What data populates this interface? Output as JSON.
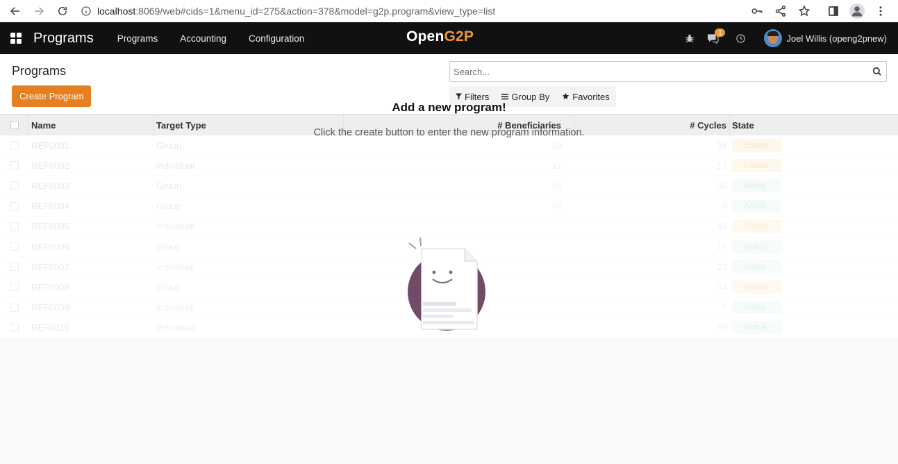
{
  "browser": {
    "url_host": "localhost",
    "url_path": ":8069/web#cids=1&menu_id=275&action=378&model=g2p.program&view_type=list"
  },
  "navbar": {
    "app_title": "Programs",
    "menu": [
      "Programs",
      "Accounting",
      "Configuration"
    ],
    "brand_part1": "Open",
    "brand_part2": "G2P",
    "messages_badge": "1",
    "user_name": "Joel Willis (openg2pnew)",
    "accent_color": "#f0972e"
  },
  "control": {
    "title": "Programs",
    "create_label": "Create Program",
    "search_placeholder": "Search...",
    "filters_label": "Filters",
    "group_by_label": "Group By",
    "favorites_label": "Favorites"
  },
  "table": {
    "headers": {
      "name": "Name",
      "target_type": "Target Type",
      "beneficiaries": "# Beneficiaries",
      "cycles": "# Cycles",
      "state": "State"
    },
    "rows": [
      {
        "name": "REF0001",
        "type": "Group",
        "beneficiaries": "39",
        "cycles": "38",
        "state": "Ended"
      },
      {
        "name": "REF0002",
        "type": "Individual",
        "beneficiaries": "17",
        "cycles": "17",
        "state": "Ended"
      },
      {
        "name": "REF0003",
        "type": "Group",
        "beneficiaries": "34",
        "cycles": "38",
        "state": "Active"
      },
      {
        "name": "REF0004",
        "type": "Group",
        "beneficiaries": "24",
        "cycles": "9",
        "state": "Active"
      },
      {
        "name": "REF0005",
        "type": "Individual",
        "beneficiaries": "",
        "cycles": "49",
        "state": "Ended"
      },
      {
        "name": "REF0006",
        "type": "Group",
        "beneficiaries": "",
        "cycles": "17",
        "state": "Active"
      },
      {
        "name": "REF0007",
        "type": "Individual",
        "beneficiaries": "",
        "cycles": "23",
        "state": "Active"
      },
      {
        "name": "REF0008",
        "type": "Group",
        "beneficiaries": "",
        "cycles": "34",
        "state": "Ended"
      },
      {
        "name": "REF0009",
        "type": "Individual",
        "beneficiaries": "",
        "cycles": "7",
        "state": "Active"
      },
      {
        "name": "REF0010",
        "type": "Individual",
        "beneficiaries": "",
        "cycles": "38",
        "state": "Active"
      }
    ]
  },
  "helper": {
    "title": "Add a new program!",
    "text": "Click the create button to enter the new program information."
  },
  "icons": {
    "back": "arrow-back-icon",
    "forward": "arrow-forward-icon",
    "reload": "reload-icon",
    "info": "info-icon",
    "key": "key-icon",
    "share": "share-icon",
    "star": "star-icon",
    "sidepanel": "side-panel-icon",
    "profile": "profile-icon",
    "menu": "kebab-menu-icon",
    "apps": "apps-grid-icon",
    "bug": "bug-icon",
    "chat": "chat-icon",
    "clock": "clock-icon",
    "search": "search-icon",
    "filter": "filter-icon",
    "groupby": "group-by-icon",
    "favorites": "favorites-star-icon"
  }
}
